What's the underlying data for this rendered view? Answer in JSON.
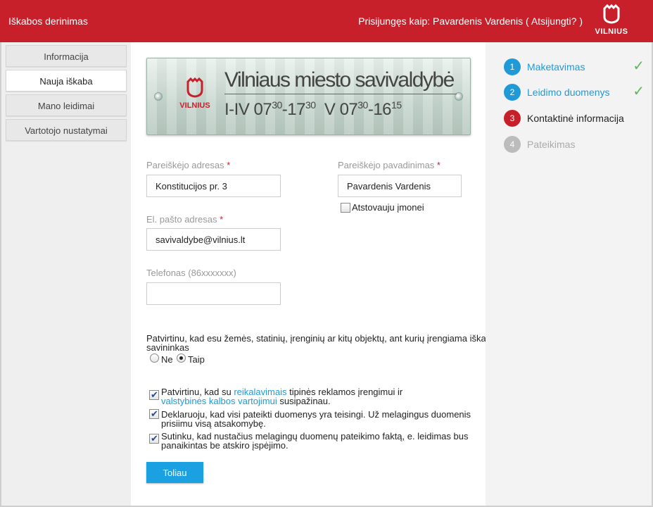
{
  "header": {
    "app_title": "Iškabos derinimas",
    "login_prefix": "Prisijungęs kaip: Pavardenis Vardenis (",
    "logout_label": "Atsijungti?",
    "login_suffix": ")",
    "logo_text": "VILNIUS"
  },
  "sidebar": {
    "items": [
      {
        "label": "Informacija"
      },
      {
        "label": "Nauja iškaba"
      },
      {
        "label": "Mano leidimai"
      },
      {
        "label": "Vartotojo nustatymai"
      }
    ],
    "active_index": 1
  },
  "banner": {
    "logo_text": "VILNIUS",
    "title": "Vilniaus miesto savivaldybė",
    "hours_days1": "I-IV 07",
    "hours_sup1": "30",
    "hours_mid1": "-17",
    "hours_sup2": "30",
    "hours_days2": "V 07",
    "hours_sup3": "30",
    "hours_mid2": "-16",
    "hours_sup4": "15"
  },
  "form": {
    "address_label": "Pareiškėjo adresas",
    "address_value": "Konstitucijos pr. 3",
    "name_label": "Pareiškėjo pavadinimas",
    "name_value": "Pavardenis Vardenis",
    "company_checkbox_label": "Atstovauju įmonei",
    "email_label": "El. pašto adresas",
    "email_value": "savivaldybe@vilnius.lt",
    "phone_label": "Telefonas (86xxxxxxx)",
    "phone_value": "",
    "required_mark": "*",
    "owner_question_line1": "Patvirtinu, kad esu žemės, statinių, įrenginių ar kitų objektų, ant kurių įrengiama iškaba",
    "owner_question_line2": "savininkas",
    "radio_no": "Ne",
    "radio_yes": "Taip",
    "confirm1_a": "Patvirtinu, kad su ",
    "confirm1_link1": "reikalavimais",
    "confirm1_b": " tipinės reklamos įrengimui ir",
    "confirm1_link2": "valstybinės kalbos vartojimui",
    "confirm1_c": " susipažinau.",
    "confirm2_line1": "Deklaruoju, kad visi pateikti duomenys yra teisingi. Už melagingus duomenis",
    "confirm2_line2": "prisiimu visą atsakomybę.",
    "confirm3_line1": "Sutinku, kad nustačius melagingų duomenų pateikimo faktą, e. leidimas bus",
    "confirm3_line2": "panaikintas be atskiro įspėjimo.",
    "next_button": "Toliau"
  },
  "steps": [
    {
      "num": "1",
      "label": "Maketavimas",
      "status": "done"
    },
    {
      "num": "2",
      "label": "Leidimo duomenys",
      "status": "done"
    },
    {
      "num": "3",
      "label": "Kontaktinė informacija",
      "status": "current"
    },
    {
      "num": "4",
      "label": "Pateikimas",
      "status": "todo"
    }
  ],
  "colors": {
    "brand_red": "#c8202b",
    "accent_blue": "#1f9ad6",
    "check_green": "#5cb85c"
  },
  "icons": {
    "logo": "vilnius-tower-logo-icon",
    "check": "check-icon"
  }
}
